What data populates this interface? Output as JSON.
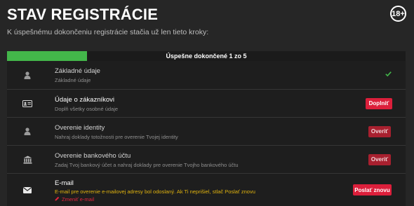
{
  "header": {
    "title": "STAV REGISTRÁCIE",
    "age_badge": "18+",
    "subtitle": "K úspešnému dokončeniu registrácie stačia už len tieto kroky:"
  },
  "progress": {
    "label": "Úspešne dokončené 1 zo 5",
    "completed": 1,
    "total": 5
  },
  "steps": [
    {
      "title": "Základné údaje",
      "description": "Základné údaje",
      "status": "done",
      "icon": "user-icon"
    },
    {
      "title": "Údaje o zákazníkovi",
      "description": "Doplň všetky osobné údaje",
      "action_label": "Doplniť",
      "icon": "id-card-icon"
    },
    {
      "title": "Overenie identity",
      "description": "Nahraj doklady totožnosti pre overenie Tvojej identity",
      "action_label": "Overiť",
      "icon": "user-icon"
    },
    {
      "title": "Overenie bankového účtu",
      "description": "Zadaj Tvoj bankový účet a nahraj doklady pre overenie Tvojho bankového účtu",
      "action_label": "Overiť",
      "icon": "bank-icon"
    },
    {
      "title": "E-mail",
      "description": "E-mail pre overenie e-mailovej adresy bol odoslaný. Ak Ti neprišiel, stlač Poslať znovu",
      "action_label": "Poslať znovu",
      "change_label": "Zmeniť e-mail",
      "icon": "envelope-icon"
    }
  ],
  "colors": {
    "background": "#262626",
    "row": "#1e1e1e",
    "progress_fill": "#43b64a",
    "primary_button": "#dc1f3b",
    "secondary_button": "#a8202f",
    "warning_text": "#e0b30e",
    "link_red": "#e3243e"
  }
}
